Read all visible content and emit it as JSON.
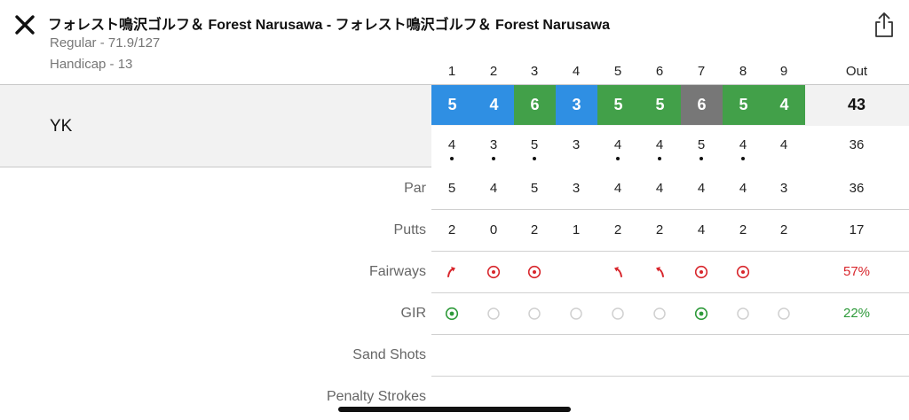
{
  "header": {
    "title": "フォレスト鳴沢ゴルフ＆ Forest Narusawa - フォレスト鳴沢ゴルフ＆ Forest Narusawa",
    "tee_info": "Regular - 71.9/127",
    "handicap": "Handicap - 13",
    "close_icon": "close-icon",
    "share_icon": "share-icon"
  },
  "columns": {
    "holes": [
      "1",
      "2",
      "3",
      "4",
      "5",
      "6",
      "7",
      "8",
      "9"
    ],
    "total_label": "Out"
  },
  "player": {
    "name": "YK",
    "scores": [
      "5",
      "4",
      "6",
      "3",
      "5",
      "5",
      "6",
      "5",
      "4"
    ],
    "score_styles": [
      "blue",
      "blue",
      "green",
      "blue",
      "green",
      "green",
      "gray",
      "green",
      "green"
    ],
    "out": "43",
    "handicap_par": [
      "4",
      "3",
      "5",
      "3",
      "4",
      "4",
      "5",
      "4",
      "4"
    ],
    "handicap_dots": [
      true,
      true,
      true,
      false,
      true,
      true,
      true,
      true,
      false
    ],
    "handicap_out": "36"
  },
  "stats": {
    "par": {
      "label": "Par",
      "values": [
        "5",
        "4",
        "5",
        "3",
        "4",
        "4",
        "4",
        "4",
        "3"
      ],
      "out": "36"
    },
    "putts": {
      "label": "Putts",
      "values": [
        "2",
        "0",
        "2",
        "1",
        "2",
        "2",
        "4",
        "2",
        "2"
      ],
      "out": "17"
    },
    "fairways": {
      "label": "Fairways",
      "icons": [
        "arrow-right-miss-icon",
        "target-hit-icon",
        "target-hit-icon",
        "",
        "arrow-left-miss-icon",
        "arrow-left-miss-icon",
        "target-hit-icon",
        "target-hit-icon",
        ""
      ],
      "out": "57%"
    },
    "gir": {
      "label": "GIR",
      "icons": [
        "gir-hit-icon",
        "gir-empty-icon",
        "gir-empty-icon",
        "gir-empty-icon",
        "gir-empty-icon",
        "gir-empty-icon",
        "gir-hit-icon",
        "gir-empty-icon",
        "gir-empty-icon"
      ],
      "out": "22%"
    },
    "sand_shots": {
      "label": "Sand Shots"
    },
    "penalty_strokes": {
      "label": "Penalty Strokes"
    }
  },
  "colors": {
    "eagle_blue": "#2f8fe3",
    "par_green": "#42a049",
    "bogey_gray": "#777777",
    "fairway_red": "#d8262c",
    "gir_green": "#2e9a3a"
  }
}
